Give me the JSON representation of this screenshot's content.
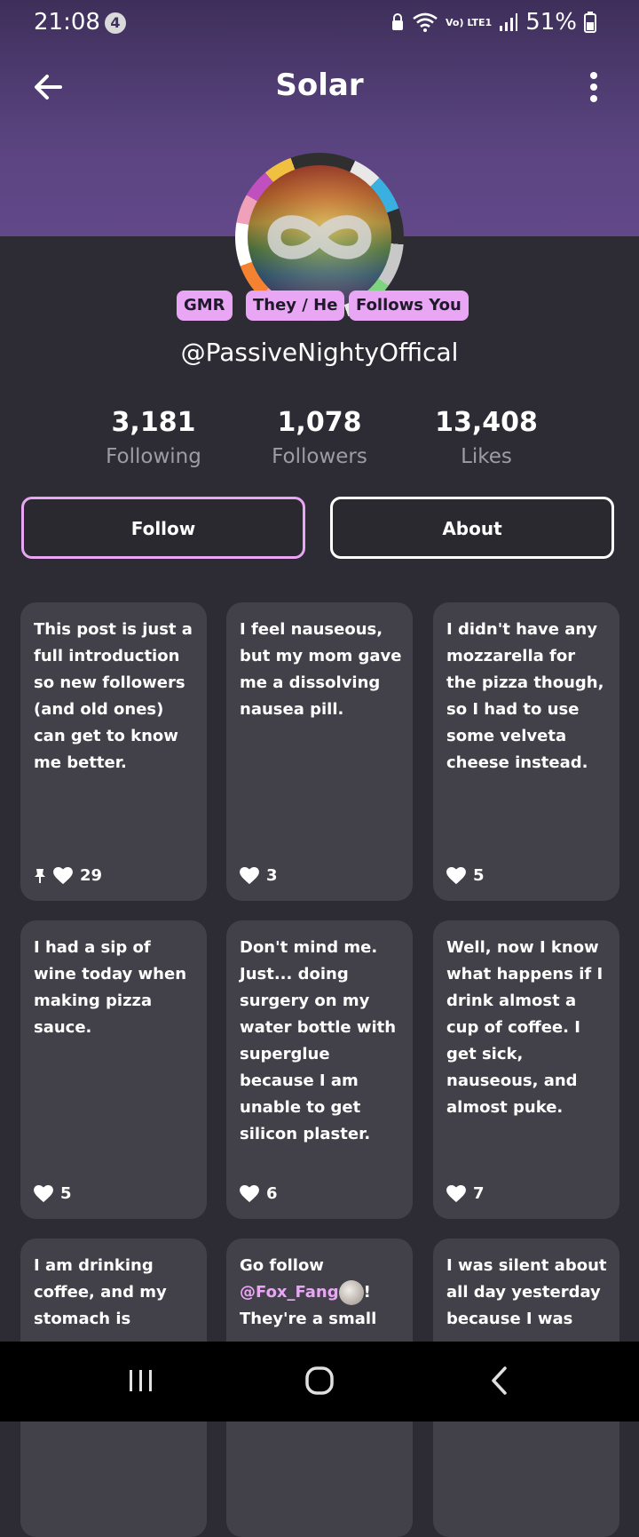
{
  "status_bar": {
    "time": "21:08",
    "notification_count": "4",
    "network": "Vo) LTE1",
    "battery": "51%"
  },
  "header": {
    "title": "Solar"
  },
  "profile": {
    "tags": [
      "GMR",
      "They / He",
      "Follows You"
    ],
    "username": "@PassiveNightyOffical",
    "stats": [
      {
        "value": "3,181",
        "label": "Following"
      },
      {
        "value": "1,078",
        "label": "Followers"
      },
      {
        "value": "13,408",
        "label": "Likes"
      }
    ]
  },
  "buttons": {
    "follow": "Follow",
    "about": "About"
  },
  "posts": [
    {
      "text": "This post is just a full introduction so new followers (and old ones) can get to know me better.",
      "likes": "29",
      "pinned": true
    },
    {
      "text": "I feel nauseous, but my mom gave me a dissolving nausea pill.",
      "likes": "3"
    },
    {
      "text": "I didn't have any mozzarella for the pizza though, so I had to use some velveta cheese instead.",
      "likes": "5"
    },
    {
      "text": "I had a sip of wine today when making pizza sauce.",
      "likes": "5"
    },
    {
      "text": "Don't mind me. Just... doing surgery on my water bottle with superglue because I am unable to get silicon plaster.",
      "likes": "6"
    },
    {
      "text": "Well, now I know what happens if I drink almost a cup of coffee. I get sick, nauseous, and almost puke.",
      "likes": "7"
    },
    {
      "text": "I am drinking coffee, and my stomach is"
    },
    {
      "text_before": "Go follow ",
      "mention": "@Fox_Fang",
      "text_after": "! They're a small"
    },
    {
      "text": "I was silent about all day yesterday because I was"
    }
  ],
  "colors": {
    "accent": "#e8a6f5",
    "header_purple": "#5a4480",
    "background": "#2d2c34",
    "card": "#424149"
  }
}
